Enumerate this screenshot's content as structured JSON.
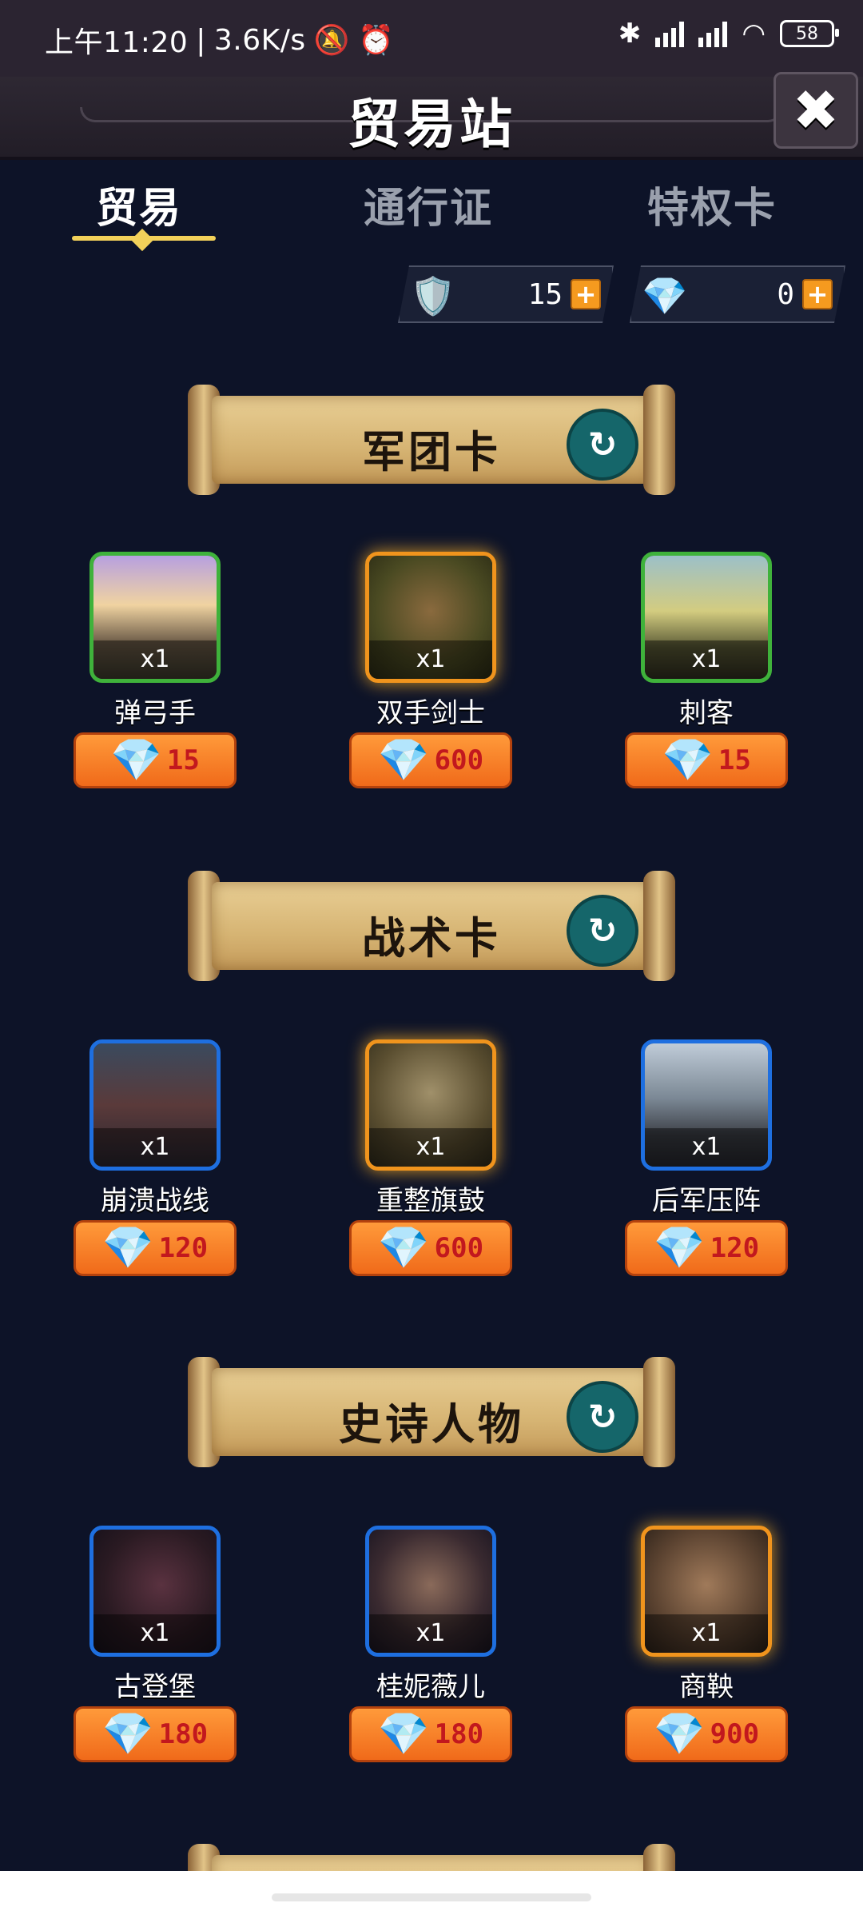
{
  "status_bar": {
    "time": "上午11:20",
    "speed": "3.6K/s",
    "battery": "58"
  },
  "header": {
    "title": "贸易站",
    "close_label": "✖"
  },
  "tabs": [
    {
      "label": "贸易",
      "active": true
    },
    {
      "label": "通行证",
      "active": false
    },
    {
      "label": "特权卡",
      "active": false
    }
  ],
  "currency": [
    {
      "icon": "crest-icon",
      "value": "15"
    },
    {
      "icon": "gem-icon",
      "value": "0"
    }
  ],
  "sections": [
    {
      "title": "军团卡",
      "cards": [
        {
          "name": "弹弓手",
          "qty": "x1",
          "price": "15",
          "frame": "green"
        },
        {
          "name": "双手剑士",
          "qty": "x1",
          "price": "600",
          "frame": "orange"
        },
        {
          "name": "刺客",
          "qty": "x1",
          "price": "15",
          "frame": "green"
        }
      ]
    },
    {
      "title": "战术卡",
      "cards": [
        {
          "name": "崩溃战线",
          "qty": "x1",
          "price": "120",
          "frame": "blue"
        },
        {
          "name": "重整旗鼓",
          "qty": "x1",
          "price": "600",
          "frame": "orange"
        },
        {
          "name": "后军压阵",
          "qty": "x1",
          "price": "120",
          "frame": "blue"
        }
      ]
    },
    {
      "title": "史诗人物",
      "cards": [
        {
          "name": "古登堡",
          "qty": "x1",
          "price": "180",
          "frame": "blue"
        },
        {
          "name": "桂妮薇儿",
          "qty": "x1",
          "price": "180",
          "frame": "blue"
        },
        {
          "name": "商鞅",
          "qty": "x1",
          "price": "900",
          "frame": "orange"
        }
      ]
    }
  ]
}
